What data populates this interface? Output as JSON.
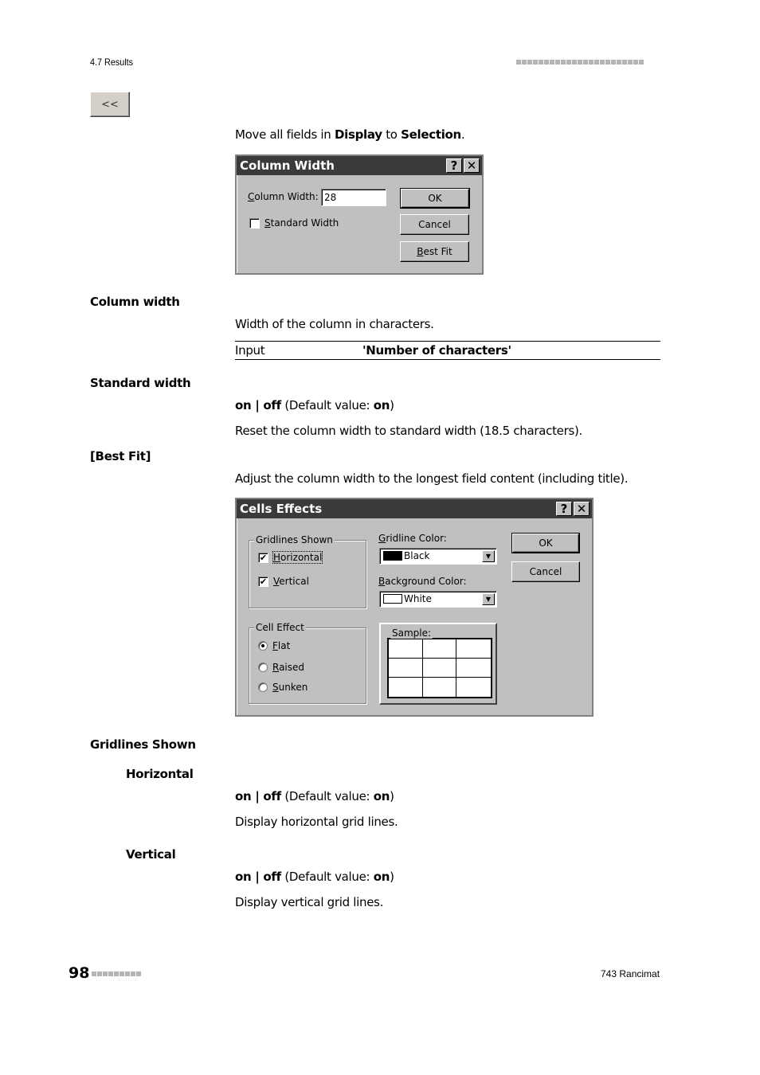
{
  "header": {
    "section": "4.7 Results"
  },
  "back_button": {
    "label": "<<"
  },
  "intro_text": {
    "prefix": "Move all fields in ",
    "b1": "Display",
    "mid": " to ",
    "b2": "Selection",
    "suffix": "."
  },
  "column_width_dialog": {
    "title": "Column Width",
    "help_label": "?",
    "close_label": "✕",
    "column_width_label_ul": "C",
    "column_width_label_rest": "olumn Width:",
    "column_width_value": "28",
    "standard_width_ul": "S",
    "standard_width_rest": "tandard Width",
    "standard_width_checked": false,
    "ok_label": "OK",
    "cancel_label": "Cancel",
    "best_fit_ul": "B",
    "best_fit_rest": "est Fit"
  },
  "sections": {
    "column_width": {
      "term": "Column width",
      "desc": "Width of the column in characters.",
      "input_label": "Input",
      "input_value": "'Number of characters'"
    },
    "standard_width": {
      "term": "Standard width",
      "on": "on",
      "sep": " | ",
      "off": "off",
      "default_prefix": " (Default value: ",
      "default_value": "on",
      "default_suffix": ")",
      "desc": "Reset the column width to standard width (18.5 characters)."
    },
    "best_fit": {
      "term": "[Best Fit]",
      "desc": "Adjust the column width to the longest field content (including title)."
    },
    "gridlines_shown": {
      "term": "Gridlines Shown"
    },
    "horizontal": {
      "term": "Horizontal",
      "on": "on",
      "sep": " | ",
      "off": "off",
      "default_prefix": " (Default value: ",
      "default_value": "on",
      "default_suffix": ")",
      "desc": "Display horizontal grid lines."
    },
    "vertical": {
      "term": "Vertical",
      "on": "on",
      "sep": " | ",
      "off": "off",
      "default_prefix": " (Default value: ",
      "default_value": "on",
      "default_suffix": ")",
      "desc": "Display vertical grid lines."
    }
  },
  "cells_effects_dialog": {
    "title": "Cells Effects",
    "help_label": "?",
    "close_label": "✕",
    "gridlines_group": "Gridlines Shown",
    "horizontal_ul": "H",
    "horizontal_rest": "orizontal",
    "horizontal_checked": true,
    "vertical_ul": "V",
    "vertical_rest": "ertical",
    "vertical_checked": true,
    "gridline_color_ul": "G",
    "gridline_color_rest": "ridline Color:",
    "gridline_color_value": "Black",
    "gridline_color_hex": "#000000",
    "background_color_ul": "B",
    "background_color_rest": "ackground Color:",
    "background_color_value": "White",
    "background_color_hex": "#ffffff",
    "cell_effect_group": "Cell Effect",
    "flat_ul": "F",
    "flat_rest": "lat",
    "raised_ul": "R",
    "raised_rest": "aised",
    "sunken_ul": "S",
    "sunken_rest": "unken",
    "selected_effect": "Flat",
    "sample_label": "Sample:",
    "ok_label": "OK",
    "cancel_label": "Cancel",
    "check_glyph": "✔",
    "arrow_glyph": "▼"
  },
  "footer": {
    "page_number": "98",
    "product": "743 Rancimat"
  }
}
